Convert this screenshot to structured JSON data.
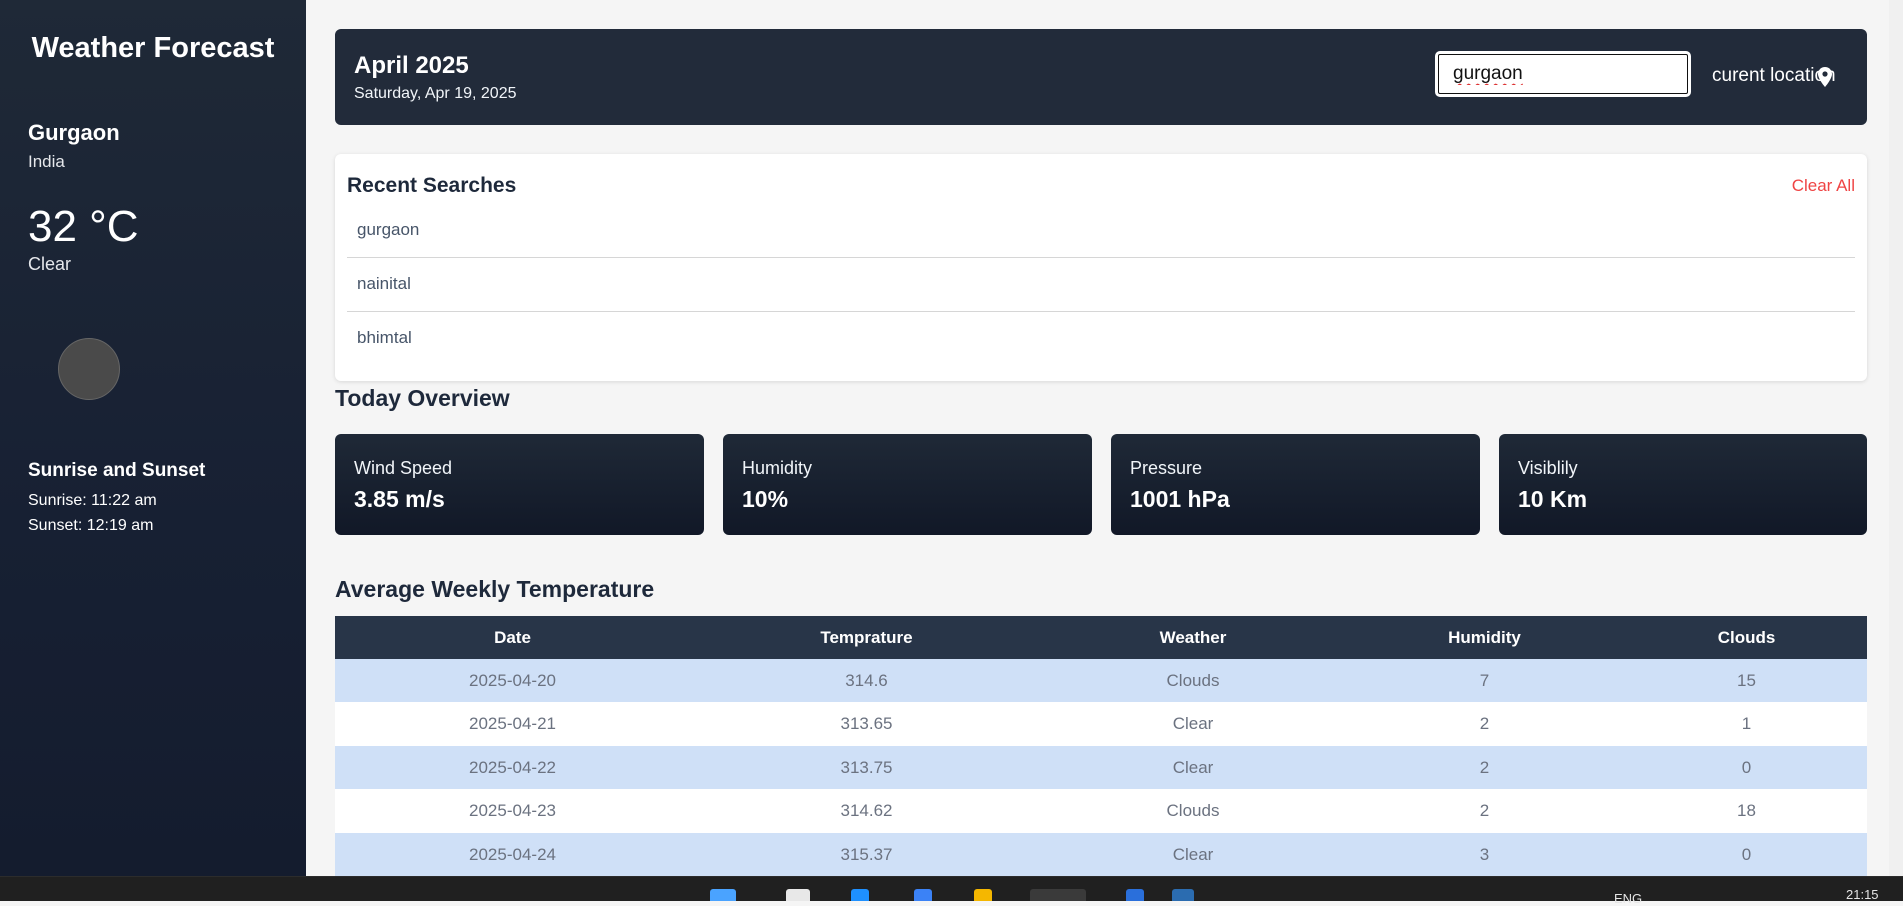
{
  "sidebar": {
    "app_title": "Weather Forecast",
    "city": "Gurgaon",
    "country": "India",
    "temperature": "32 °C",
    "condition": "Clear",
    "sun_heading": "Sunrise and Sunset",
    "sunrise": "Sunrise: 11:22 am",
    "sunset": "Sunset: 12:19 am"
  },
  "header": {
    "month": "April 2025",
    "date": "Saturday, Apr 19, 2025",
    "search_value": "gurgaon",
    "location_button": "curent location",
    "location_icon": "map-pin-icon"
  },
  "recent": {
    "title": "Recent Searches",
    "clear_label": "Clear All",
    "items": [
      "gurgaon",
      "nainital",
      "bhimtal"
    ]
  },
  "overview": {
    "title": "Today Overview",
    "cards": [
      {
        "label": "Wind Speed",
        "value": "3.85 m/s"
      },
      {
        "label": "Humidity",
        "value": "10%"
      },
      {
        "label": "Pressure",
        "value": "1001 hPa"
      },
      {
        "label": "Visiblily",
        "value": "10 Km"
      }
    ]
  },
  "weekly": {
    "title": "Average Weekly Temperature",
    "columns": [
      "Date",
      "Temprature",
      "Weather",
      "Humidity",
      "Clouds"
    ],
    "rows": [
      [
        "2025-04-20",
        "314.6",
        "Clouds",
        "7",
        "15"
      ],
      [
        "2025-04-21",
        "313.65",
        "Clear",
        "2",
        "1"
      ],
      [
        "2025-04-22",
        "313.75",
        "Clear",
        "2",
        "0"
      ],
      [
        "2025-04-23",
        "314.62",
        "Clouds",
        "2",
        "18"
      ],
      [
        "2025-04-24",
        "315.37",
        "Clear",
        "3",
        "0"
      ]
    ]
  },
  "taskbar": {
    "language": "ENG",
    "time": "21:15"
  }
}
